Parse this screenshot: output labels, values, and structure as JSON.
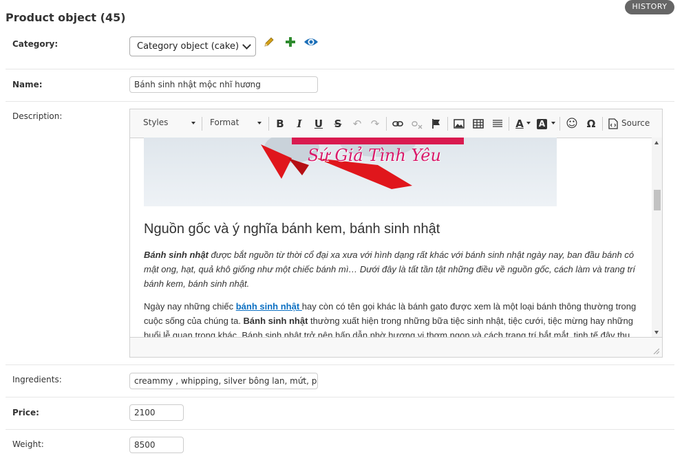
{
  "page": {
    "title": "Product object (45)",
    "history_label": "HISTORY"
  },
  "category": {
    "label": "Category:",
    "selected": "Category object (cake)"
  },
  "name": {
    "label": "Name:",
    "value": "Bánh sinh nhật mộc nhĩ hương"
  },
  "description": {
    "label": "Description:",
    "toolbar": {
      "styles": "Styles",
      "format": "Format",
      "source": "Source"
    },
    "image_caption": "Sứ Giả Tình Yêu",
    "heading": "Nguồn gốc và ý nghĩa bánh kem, bánh sinh nhật",
    "para1_bold": "Bánh sinh nhật",
    "para1_rest": " được bắt nguồn từ thời cổ đại xa xưa với hình dạng rất khác với bánh sinh nhật ngày nay, ban đầu bánh có mật ong, hạt, quả khô giống như một chiếc bánh mì… Dưới đây là tất tần tật những điều về nguồn gốc, cách làm và trang trí bánh kem, bánh sinh nhật.",
    "para2_a": "Ngày nay những chiếc ",
    "para2_link": "bánh sinh nhật ",
    "para2_b": "hay còn có tên gọi khác là bánh gato được xem là một loại bánh thông thường trong cuộc sống của chúng ta. ",
    "para2_bold": "Bánh sinh nhật",
    "para2_c": " thường xuất hiện trong những bữa tiệc sinh nhật, tiệc cưới, tiệc mừng hay những buổi lễ quan trọng khác. Bánh sinh nhật trở nên hấp dẫn nhờ hương vị thơm ngon và cách trang trí bắt mắt, tinh tế đây thu"
  },
  "ingredients": {
    "label": "Ingredients:",
    "value": "creammy , whipping, silver bông lan, mứt, ph"
  },
  "price": {
    "label": "Price:",
    "value": "2100"
  },
  "weight": {
    "label": "Weight:",
    "value": "8500"
  },
  "colors": {
    "accent": "#0a6fc2",
    "pencil": "#d4a017",
    "plus": "#2e8b2e",
    "eye": "#1c6fb8",
    "ribbon": "#e0161c"
  }
}
